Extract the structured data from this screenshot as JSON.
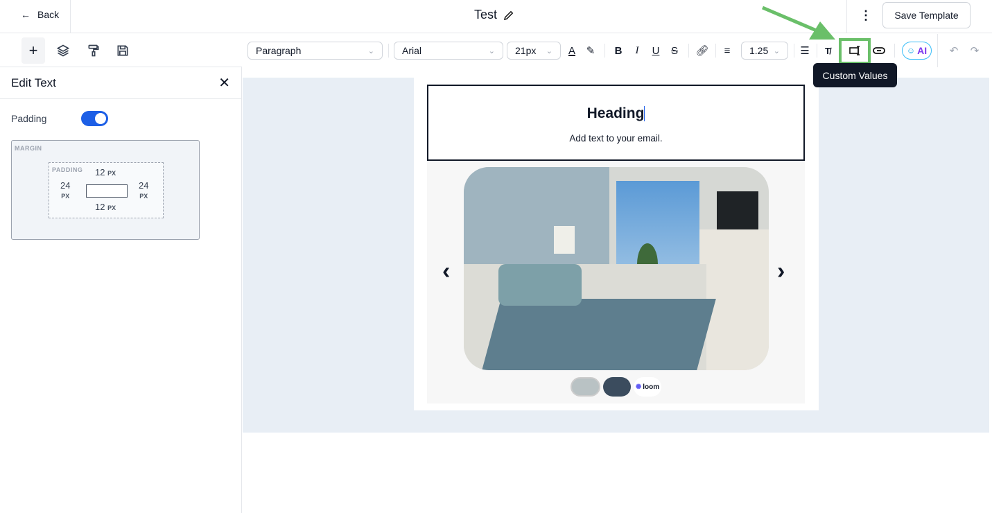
{
  "header": {
    "back_label": "Back",
    "title": "Test",
    "save_label": "Save Template"
  },
  "left_tools": [
    "add-icon",
    "layers-icon",
    "paint-roller-icon",
    "save-icon"
  ],
  "panel": {
    "title": "Edit Text",
    "padding_label": "Padding",
    "padding_enabled": true,
    "margin_label": "MARGIN",
    "padding_box_label": "PADDING",
    "top": "12",
    "bottom": "12",
    "left": "24",
    "right": "24",
    "unit": "PX"
  },
  "toolbar": {
    "block_type": "Paragraph",
    "font": "Arial",
    "size": "21px",
    "line_height": "1.25",
    "ai_label": "AI",
    "tooltip": "Custom Values"
  },
  "email": {
    "heading": "Heading",
    "body": "Add text to your email.",
    "thumb_logo": "loom"
  },
  "colors": {
    "accent": "#1d5fe6",
    "annotation": "#6abf69",
    "canvas": "#e8eef5"
  }
}
